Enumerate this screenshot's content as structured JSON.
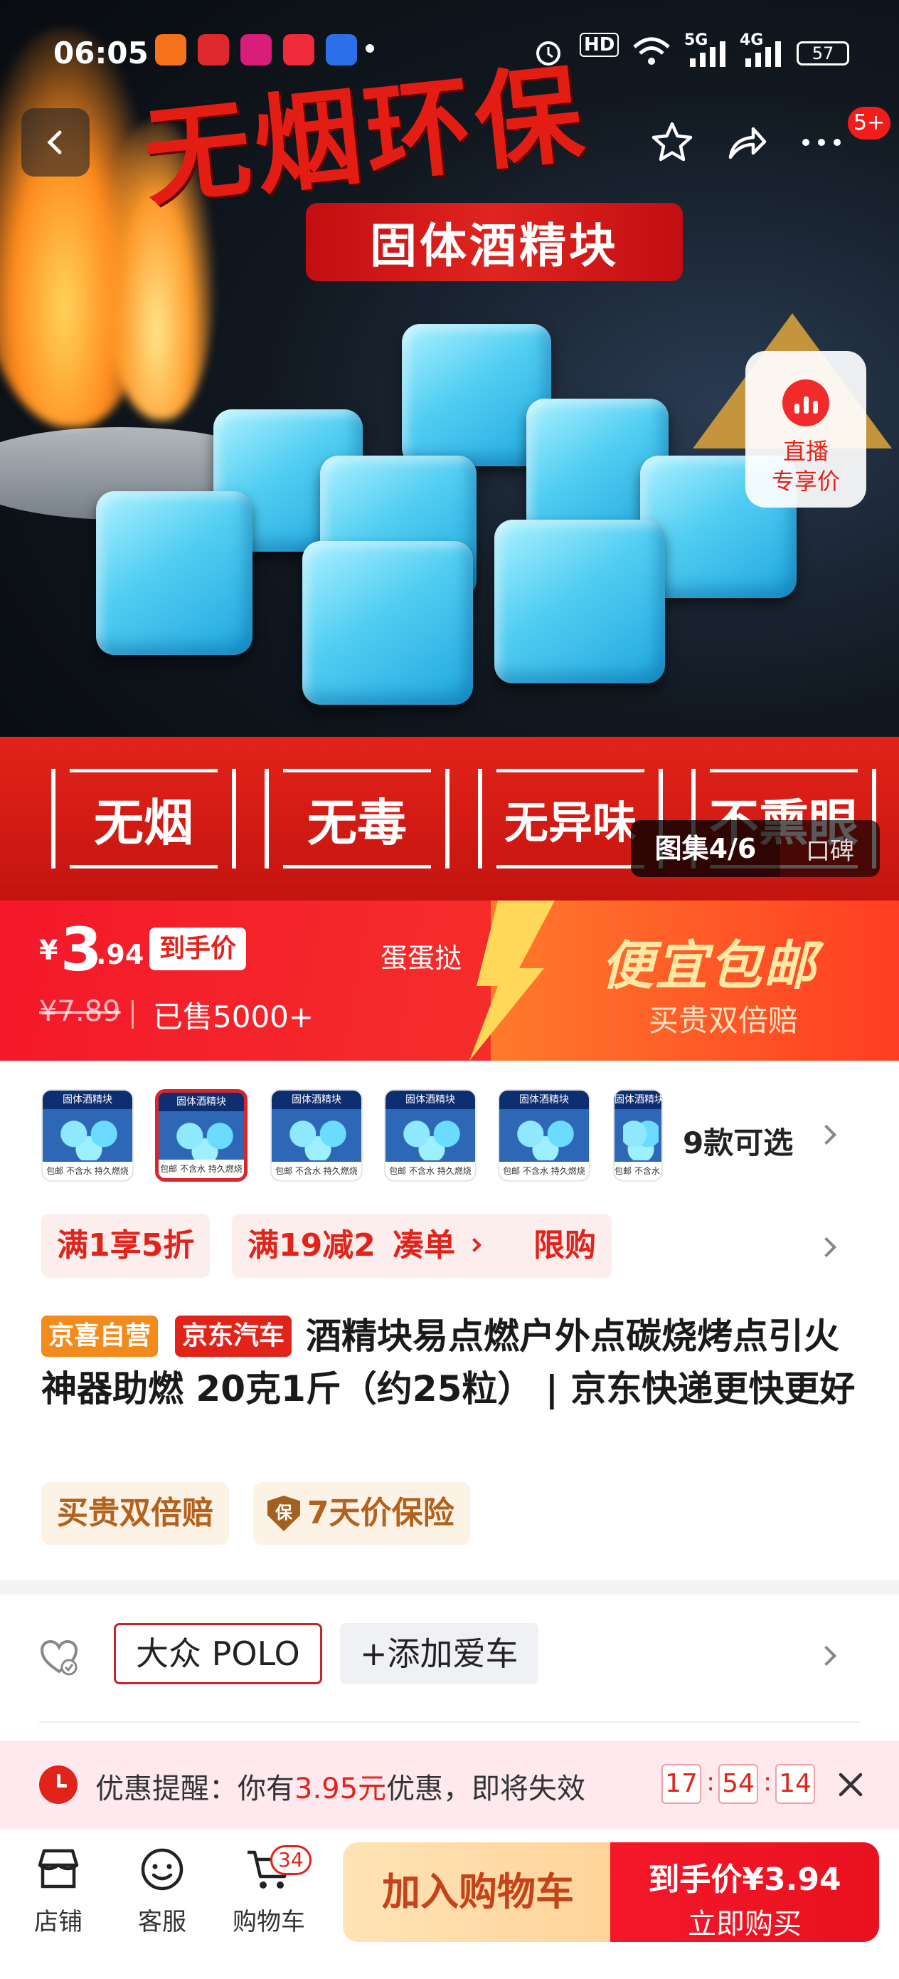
{
  "status_bar": {
    "time": "06:05",
    "hd_label": "HD",
    "net1": "5G",
    "net2": "4G",
    "battery": "57",
    "app_icons": [
      "app-icon-orange",
      "app-icon-pinduoduo",
      "app-icon-vip",
      "app-icon-xiaohongshu",
      "app-icon-baidu"
    ]
  },
  "top_nav": {
    "more_badge": "5+"
  },
  "hero": {
    "headline": "无烟环保",
    "subheadline": "固体酒精块",
    "features": [
      "无烟",
      "无毒",
      "无异味",
      "不熏眼"
    ],
    "live": {
      "title": "直播",
      "subtitle": "专享价"
    },
    "gallery": {
      "count": "图集4/6",
      "review": "口碑"
    }
  },
  "price": {
    "currency": "¥",
    "integer": "3",
    "decimal": ".94",
    "tag": "到手价",
    "seller": "蛋蛋挞",
    "original": "¥7.89",
    "sold": "已售5000+",
    "promo_title": "便宜包邮",
    "promo_subtitle": "买贵双倍赔"
  },
  "variants": {
    "thumb_header": "固体酒精块",
    "thumb_footer": "包邮  不含水  持久燃烧",
    "thumbnails": 6,
    "selected_index": 1,
    "count_label": "9款可选"
  },
  "coupons": [
    "满1享5折",
    "满19减2",
    "凑单",
    "限购"
  ],
  "product": {
    "tags": [
      "京喜自营",
      "京东汽车"
    ],
    "title": "酒精块易点燃户外点碳烧烤点引火神器助燃 20克1斤（约25粒） | 京东快递更快更好",
    "guarantees": [
      "买贵双倍赔",
      "7天价保险"
    ],
    "guarantee_icon_text": "保"
  },
  "car": {
    "model": "大众 POLO",
    "add_label": "+添加爱车"
  },
  "reminder": {
    "prefix": "优惠提醒：你有",
    "amount": "3.95元",
    "suffix": "优惠，即将失效",
    "countdown": [
      "17",
      "54",
      "14"
    ]
  },
  "bottom_bar": {
    "nav": [
      "店铺",
      "客服",
      "购物车"
    ],
    "cart_count": "34",
    "add_cart": "加入购物车",
    "buy_price": "到手价¥3.94",
    "buy_label": "立即购买"
  },
  "colors": {
    "brand_red": "#e2231a",
    "price_bar_start": "#f4182a",
    "promo_orange": "#ff7a2c",
    "add_cart_bg": "#ffd49a"
  }
}
